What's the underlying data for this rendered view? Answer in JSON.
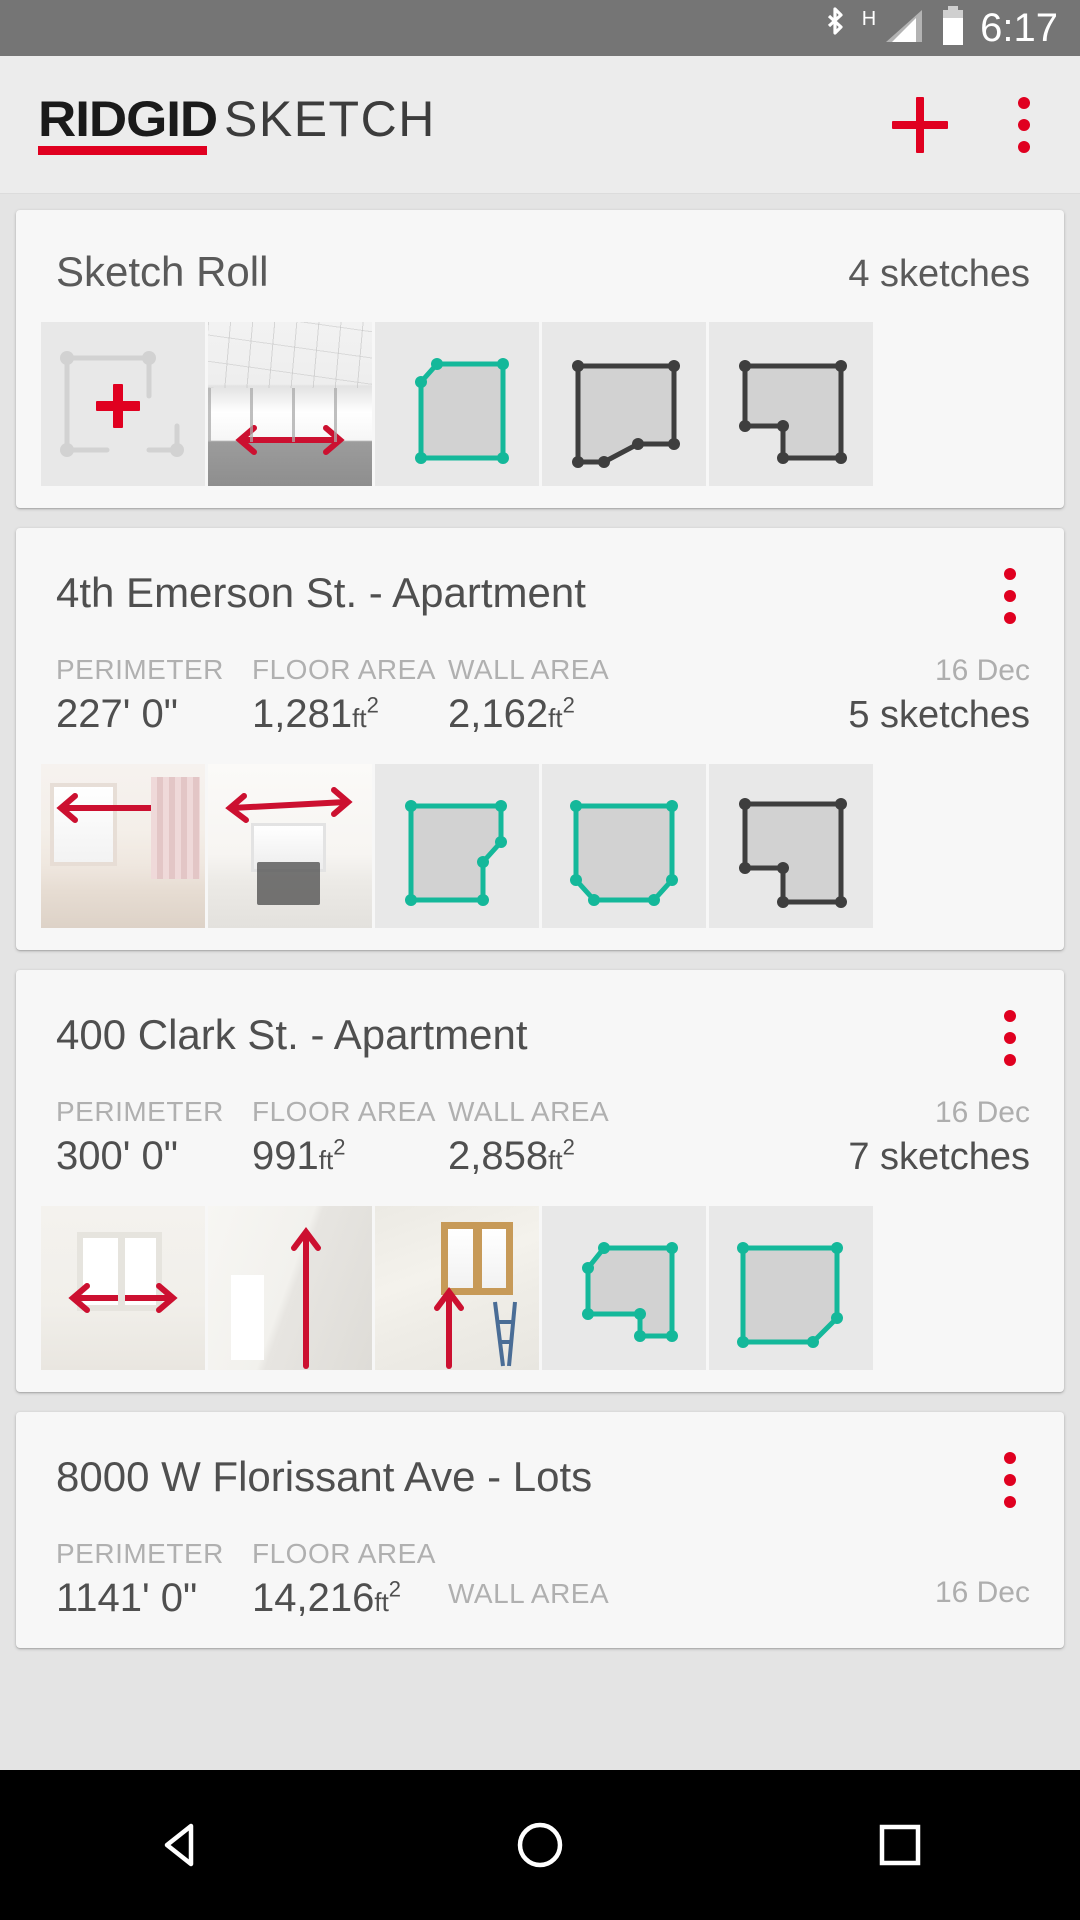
{
  "status_bar": {
    "network_label": "H",
    "time": "6:17",
    "icons": [
      "bluetooth-icon",
      "signal-icon",
      "battery-icon"
    ]
  },
  "app_bar": {
    "brand_name": "RIDGID",
    "brand_sub": "SKETCH",
    "add_label": "+",
    "overflow_label": "More options",
    "accent_color": "#e00020"
  },
  "sketch_roll": {
    "title": "Sketch Roll",
    "count_label": "4 sketches",
    "thumbs": [
      {
        "type": "new-sketch"
      },
      {
        "type": "photo",
        "style": "ph-office",
        "arrow": "horizontal"
      },
      {
        "type": "shape",
        "color": "#14b89a",
        "shape": "clipped-corner"
      },
      {
        "type": "shape",
        "color": "#3e3e3e",
        "shape": "notched-bottom"
      },
      {
        "type": "shape",
        "color": "#3e3e3e",
        "shape": "l-shape"
      }
    ]
  },
  "projects": [
    {
      "title": "4th Emerson St. - Apartment",
      "stats": [
        {
          "label": "PERIMETER",
          "value": "227' 0\"",
          "unit": ""
        },
        {
          "label": "FLOOR AREA",
          "value": "1,281",
          "unit": "ft",
          "exp": "2"
        },
        {
          "label": "WALL AREA",
          "value": "2,162",
          "unit": "ft",
          "exp": "2"
        }
      ],
      "date": "16 Dec",
      "count_label": "5 sketches",
      "thumbs": [
        {
          "type": "photo",
          "style": "ph-living",
          "arrow": "horizontal"
        },
        {
          "type": "photo",
          "style": "ph-kitchen",
          "arrow": "horizontal"
        },
        {
          "type": "shape",
          "color": "#14b89a",
          "shape": "notch-right"
        },
        {
          "type": "shape",
          "color": "#14b89a",
          "shape": "octagon"
        },
        {
          "type": "shape",
          "color": "#3e3e3e",
          "shape": "l-shape"
        }
      ]
    },
    {
      "title": "400 Clark St. - Apartment",
      "stats": [
        {
          "label": "PERIMETER",
          "value": "300' 0\"",
          "unit": ""
        },
        {
          "label": "FLOOR AREA",
          "value": "991",
          "unit": "ft",
          "exp": "2"
        },
        {
          "label": "WALL AREA",
          "value": "2,858",
          "unit": "ft",
          "exp": "2"
        }
      ],
      "date": "16 Dec",
      "count_label": "7 sketches",
      "thumbs": [
        {
          "type": "photo",
          "style": "ph-window",
          "arrow": "horizontal"
        },
        {
          "type": "photo",
          "style": "ph-hall",
          "arrow": "vertical"
        },
        {
          "type": "photo",
          "style": "ph-attic",
          "arrow": "vertical"
        },
        {
          "type": "shape",
          "color": "#14b89a",
          "shape": "step-right"
        },
        {
          "type": "shape",
          "color": "#14b89a",
          "shape": "diag-bottom"
        }
      ]
    },
    {
      "title": "8000 W Florissant Ave - Lots",
      "stats": [
        {
          "label": "PERIMETER",
          "value": "1141' 0\"",
          "unit": ""
        },
        {
          "label": "FLOOR AREA",
          "value": "14,216",
          "unit": "ft",
          "exp": "2"
        },
        {
          "label": "WALL AREA",
          "value": "",
          "unit": "",
          "exp": ""
        }
      ],
      "date": "16 Dec",
      "count_label": "",
      "thumbs": []
    }
  ],
  "nav_bar": {
    "back_label": "Back",
    "home_label": "Home",
    "recents_label": "Recents"
  }
}
